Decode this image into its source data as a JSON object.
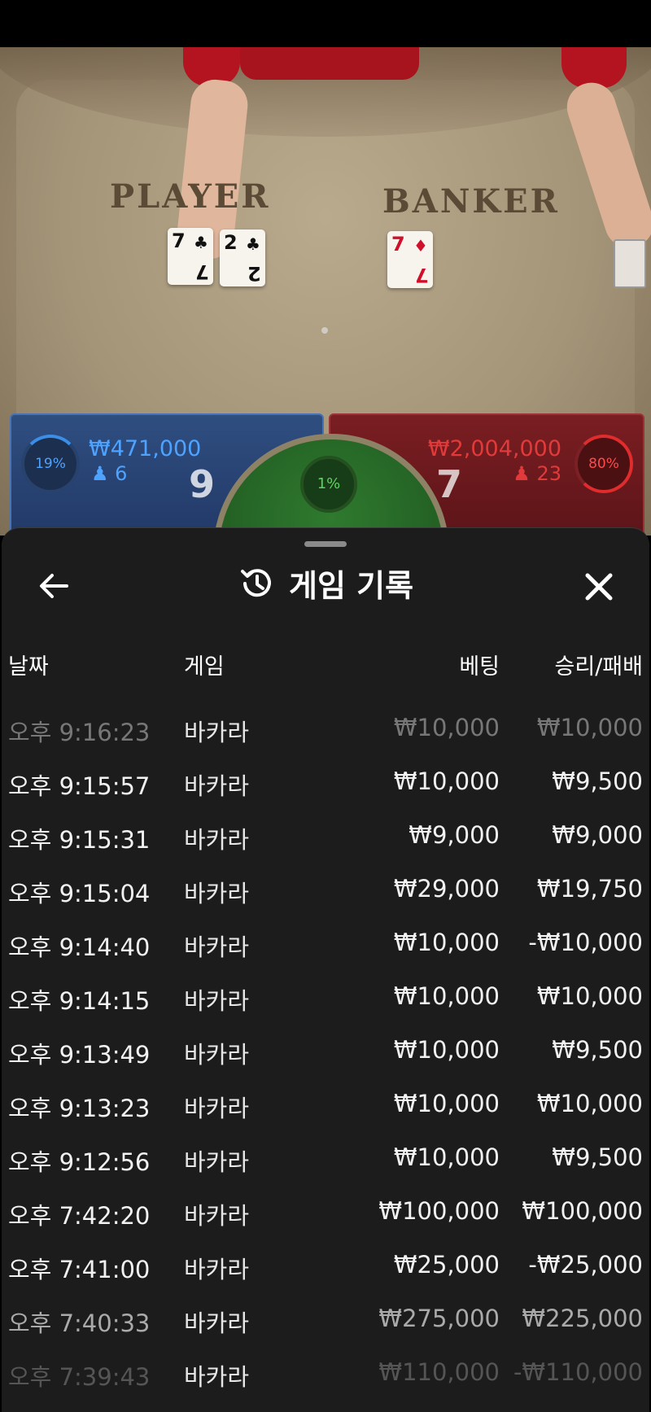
{
  "table": {
    "player_label": "PLAYER",
    "banker_label": "BANKER",
    "player_cards": [
      {
        "rank": "7",
        "suit": "♣"
      },
      {
        "rank": "2",
        "suit": "♣"
      }
    ],
    "banker_cards": [
      {
        "rank": "7",
        "suit": "♦"
      }
    ]
  },
  "bets": {
    "player": {
      "percent": "19%",
      "amount": "₩471,000",
      "count": "6",
      "score": "9"
    },
    "banker": {
      "percent": "80%",
      "amount": "₩2,004,000",
      "count": "23",
      "score": "7"
    },
    "tie": {
      "percent": "1%"
    }
  },
  "history": {
    "title": "게임 기록",
    "columns": {
      "date": "날짜",
      "game": "게임",
      "bet": "베팅",
      "winloss": "승리/패배"
    },
    "rows": [
      {
        "date": "오후 9:16:23",
        "game": "바카라",
        "bet": "₩10,000",
        "win": "₩10,000"
      },
      {
        "date": "오후 9:15:57",
        "game": "바카라",
        "bet": "₩10,000",
        "win": "₩9,500"
      },
      {
        "date": "오후 9:15:31",
        "game": "바카라",
        "bet": "₩9,000",
        "win": "₩9,000"
      },
      {
        "date": "오후 9:15:04",
        "game": "바카라",
        "bet": "₩29,000",
        "win": "₩19,750"
      },
      {
        "date": "오후 9:14:40",
        "game": "바카라",
        "bet": "₩10,000",
        "win": "-₩10,000"
      },
      {
        "date": "오후 9:14:15",
        "game": "바카라",
        "bet": "₩10,000",
        "win": "₩10,000"
      },
      {
        "date": "오후 9:13:49",
        "game": "바카라",
        "bet": "₩10,000",
        "win": "₩9,500"
      },
      {
        "date": "오후 9:13:23",
        "game": "바카라",
        "bet": "₩10,000",
        "win": "₩10,000"
      },
      {
        "date": "오후 9:12:56",
        "game": "바카라",
        "bet": "₩10,000",
        "win": "₩9,500"
      },
      {
        "date": "오후 7:42:20",
        "game": "바카라",
        "bet": "₩100,000",
        "win": "₩100,000"
      },
      {
        "date": "오후 7:41:00",
        "game": "바카라",
        "bet": "₩25,000",
        "win": "-₩25,000"
      },
      {
        "date": "오후 7:40:33",
        "game": "바카라",
        "bet": "₩275,000",
        "win": "₩225,000"
      },
      {
        "date": "오후 7:39:43",
        "game": "바카라",
        "bet": "₩110,000",
        "win": "-₩110,000"
      }
    ]
  },
  "icons": {
    "back": "arrow-left-icon",
    "history": "history-clock-icon",
    "close": "close-icon",
    "person": "person-icon"
  }
}
